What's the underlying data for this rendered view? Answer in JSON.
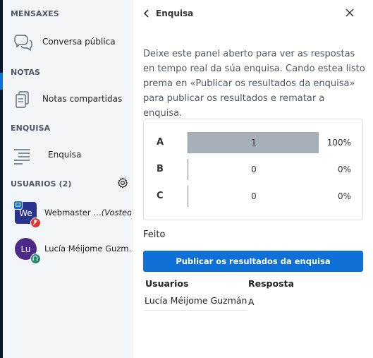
{
  "sidebar": {
    "messages_title": "MENSAXES",
    "public_chat_label": "Conversa pública",
    "notes_title": "NOTAS",
    "shared_notes_label": "Notas compartidas",
    "poll_title": "ENQUISA",
    "poll_label": "Enquisa",
    "users_title": "USUARIOS (2)",
    "users": [
      {
        "initials": "We",
        "name": "Webmaster …",
        "you_label": "(Vostede)",
        "color": "#2a3290"
      },
      {
        "initials": "Lu",
        "name": "Lucía Méijome Guzm…",
        "color": "#4a2a86"
      }
    ]
  },
  "panel": {
    "title": "Enquisa",
    "info": "Deixe este panel aberto para ver as respostas en tempo real da súa enquisa. Cando estea listo prema en «Publicar os resultados da enquisa» para publicar os resultados e rematar a enquisa.",
    "results": [
      {
        "key": "A",
        "count": "1",
        "percent": "100%",
        "fraction": 1.0
      },
      {
        "key": "B",
        "count": "0",
        "percent": "0%",
        "fraction": 0.0
      },
      {
        "key": "C",
        "count": "0",
        "percent": "0%",
        "fraction": 0.0
      }
    ],
    "done_text": "Feito",
    "publish_label": "Publicar os resultados da enquisa",
    "responses": {
      "col_user": "Usuarios",
      "col_answer": "Resposta",
      "rows": [
        {
          "user": "Lucía Méijome Guzmán",
          "answer": "A"
        }
      ]
    }
  },
  "colors": {
    "accent": "#0f70d7",
    "bar": "#a6b0b9",
    "muted_status": "#e03535",
    "online_status": "#1f8a6e"
  }
}
